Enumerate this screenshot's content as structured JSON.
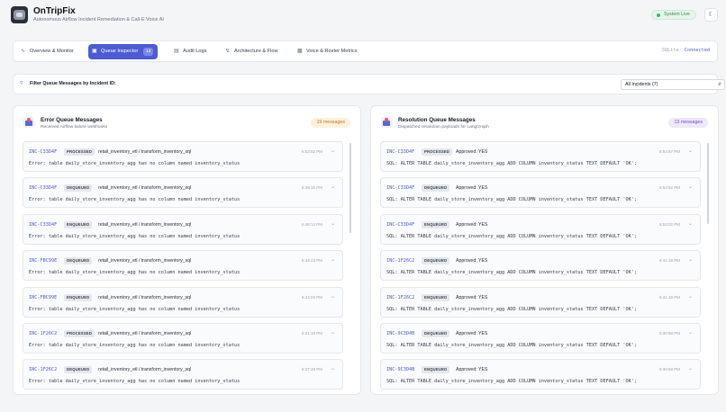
{
  "header": {
    "title": "OnTripFix",
    "subtitle": "Autonomous Airflow Incident Remediation & Call-E Voice AI",
    "status": "System Live",
    "theme_icon": "moon-icon"
  },
  "tabs": [
    {
      "label": "Overview & Monitor",
      "icon": "activity-icon"
    },
    {
      "label": "Queue Inspector",
      "icon": "inbox-icon",
      "badge": "12",
      "active": true
    },
    {
      "label": "Audit Logs",
      "icon": "file-text-icon"
    },
    {
      "label": "Architecture & Flow",
      "icon": "workflow-icon"
    },
    {
      "label": "Voice & Roster Metrics",
      "icon": "bar-chart-icon"
    }
  ],
  "db_status": {
    "label": "SQLite:",
    "value": "Connected"
  },
  "filter": {
    "label": "Filter Queue Messages by Incident ID:",
    "selected": "All Incidents (7)"
  },
  "error_queue": {
    "title": "Error Queue Messages",
    "subtitle": "Received Airflow failure webhooks",
    "count": "19 messages",
    "messages": [
      {
        "incident": "INC-C33D4F",
        "status": "PROCESSED",
        "task": "retail_inventory_etl / transform_inventory_sql",
        "time": "6:53:52 PM",
        "detail": "Error: table daily_store_inventory_agg has no column named inventory_status"
      },
      {
        "incident": "INC-C33D4F",
        "status": "DEQUEUED",
        "task": "retail_inventory_etl / transform_inventory_sql",
        "time": "6:49:15 PM",
        "detail": "Error: table daily_store_inventory_agg has no column named inventory_status"
      },
      {
        "incident": "INC-C33D4F",
        "status": "ENQUEUED",
        "task": "retail_inventory_etl / transform_inventory_sql",
        "time": "6:48:14 PM",
        "detail": "Error: table daily_store_inventory_agg has no column named inventory_status"
      },
      {
        "incident": "INC-FBC99E",
        "status": "DEQUEUED",
        "task": "retail_inventory_etl / transform_inventory_sql",
        "time": "6:44:23 PM",
        "detail": "Error: table daily_store_inventory_agg has no column named inventory_status"
      },
      {
        "incident": "INC-FBC99E",
        "status": "ENQUEUED",
        "task": "retail_inventory_etl / transform_inventory_sql",
        "time": "6:44:03 PM",
        "detail": "Error: table daily_store_inventory_agg has no column named inventory_status"
      },
      {
        "incident": "INC-1F26C2",
        "status": "PROCESSED",
        "task": "retail_inventory_etl / transform_inventory_sql",
        "time": "6:41:18 PM",
        "detail": "Error: table daily_store_inventory_agg has no column named inventory_status"
      },
      {
        "incident": "INC-1F26C2",
        "status": "DEQUEUED",
        "task": "retail_inventory_etl / transform_inventory_sql",
        "time": "6:37:48 PM",
        "detail": "Error: table daily_store_inventory_agg has no column named inventory_status"
      }
    ]
  },
  "resolution_queue": {
    "title": "Resolution Queue Messages",
    "subtitle": "Dispatched resolution payloads for LangGraph",
    "count": "13 messages",
    "messages": [
      {
        "incident": "INC-C33D4F",
        "status": "PROCESSED",
        "task": "Approved: YES",
        "time": "6:54:57 PM",
        "detail": "SQL: ALTER TABLE daily_store_inventory_agg ADD COLUMN inventory_status TEXT DEFAULT 'OK';"
      },
      {
        "incident": "INC-C33D4F",
        "status": "DEQUEUED",
        "task": "Approved: YES",
        "time": "6:53:52 PM",
        "detail": "SQL: ALTER TABLE daily_store_inventory_agg ADD COLUMN inventory_status TEXT DEFAULT 'OK';"
      },
      {
        "incident": "INC-C33D4F",
        "status": "ENQUEUED",
        "task": "Approved: YES",
        "time": "6:53:02 PM",
        "detail": "SQL: ALTER TABLE daily_store_inventory_agg ADD COLUMN inventory_status TEXT DEFAULT 'OK';"
      },
      {
        "incident": "INC-1F26C2",
        "status": "DEQUEUED",
        "task": "Approved: YES",
        "time": "6:41:18 PM",
        "detail": "SQL: ALTER TABLE daily_store_inventory_agg ADD COLUMN inventory_status TEXT DEFAULT 'OK';"
      },
      {
        "incident": "INC-1F26C2",
        "status": "ENQUEUED",
        "task": "Approved: YES",
        "time": "6:41:18 PM",
        "detail": "SQL: ALTER TABLE daily_store_inventory_agg ADD COLUMN inventory_status TEXT DEFAULT 'OK';"
      },
      {
        "incident": "INC-9C3D4B",
        "status": "DEQUEUED",
        "task": "Approved: YES",
        "time": "6:30:58 PM",
        "detail": "SQL: ALTER TABLE daily_store_inventory_agg ADD COLUMN inventory_status TEXT DEFAULT 'OK';"
      },
      {
        "incident": "INC-9C3D4B",
        "status": "ENQUEUED",
        "task": "Approved: YES",
        "time": "6:30:58 PM",
        "detail": "SQL: ALTER TABLE daily_store_inventory_agg ADD COLUMN inventory_status TEXT DEFAULT 'OK';"
      }
    ]
  },
  "colors": {
    "accent": "#4c5bd4",
    "live": "#3fb96b",
    "error_count": "#b7791f",
    "resolution_count": "#6b4bd1"
  }
}
